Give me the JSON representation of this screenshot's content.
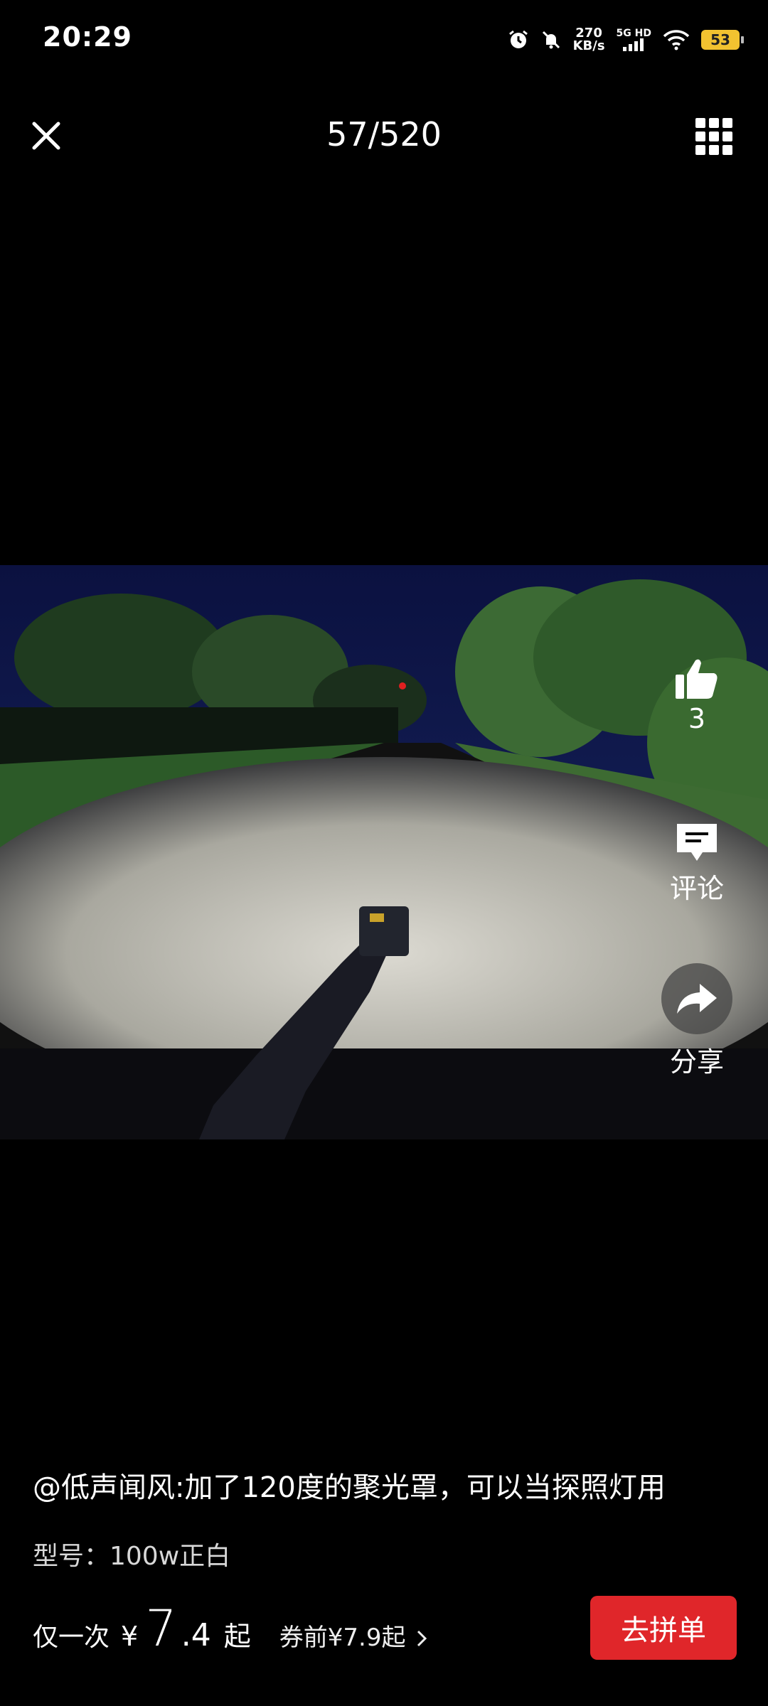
{
  "status": {
    "time": "20:29",
    "speed_value": "270",
    "speed_unit": "KB/s",
    "network": "5G HD",
    "battery": "53",
    "icons": [
      "alarm-icon",
      "mute-bell-icon",
      "signal-icon",
      "wifi-icon",
      "battery-icon"
    ]
  },
  "header": {
    "counter": "57/520",
    "close_icon": "close-icon",
    "grid_icon": "grid-icon"
  },
  "side_actions": {
    "like_count": "3",
    "comment_label": "评论",
    "share_label": "分享"
  },
  "bottom": {
    "caption": "@低声闻风:加了120度的聚光罩，可以当探照灯用",
    "spec": "型号：100w正白",
    "price_prefix": "仅一次",
    "price_currency": "¥",
    "price_int": "7",
    "price_dec": ".4",
    "price_suffix": "起",
    "coupon": "券前¥7.9起",
    "join_button": "去拼单"
  },
  "colors": {
    "accent_red": "#e0262a",
    "battery_yellow": "#f2c230",
    "background": "#000000"
  }
}
